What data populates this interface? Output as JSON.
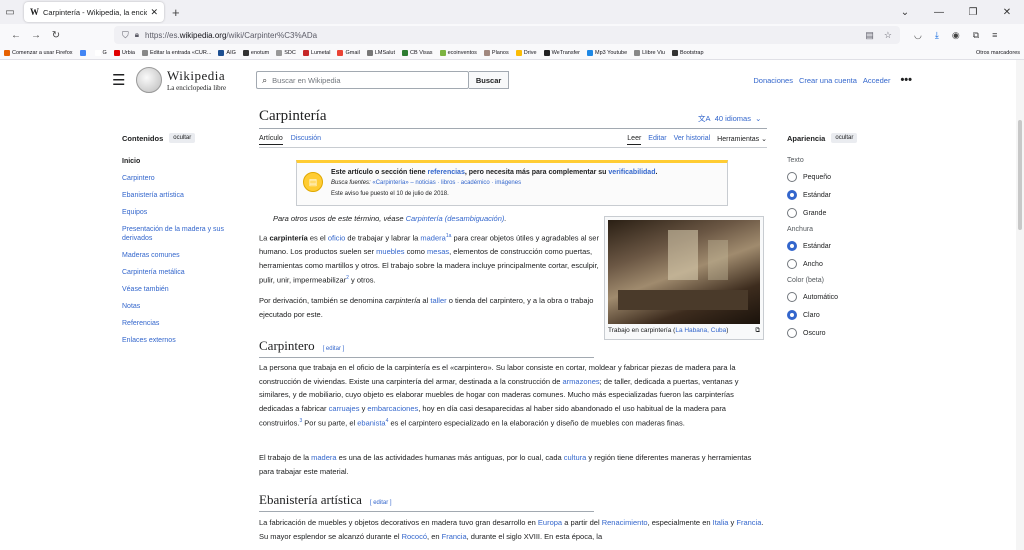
{
  "browser": {
    "tab_title": "Carpintería - Wikipedia, la encic",
    "tab_favicon": "W",
    "url_prefix": "https://es.",
    "url_host": "wikipedia.org",
    "url_path": "/wiki/Carpinter%C3%ADa",
    "bookmarks": [
      {
        "label": "Comenzar a usar Firefox",
        "color": "#e66000"
      },
      {
        "label": "",
        "color": "#4285f4"
      },
      {
        "label": "G",
        "color": "#ffffff"
      },
      {
        "label": "Urbia",
        "color": "#e00000"
      },
      {
        "label": "Editar la entrada «CUR...",
        "color": "#888888"
      },
      {
        "label": "AIG",
        "color": "#1d4f91"
      },
      {
        "label": "enotum",
        "color": "#333333"
      },
      {
        "label": "SDC",
        "color": "#999999"
      },
      {
        "label": "Lumetal",
        "color": "#c62828"
      },
      {
        "label": "Gmail",
        "color": "#ea4335"
      },
      {
        "label": "LMSalut",
        "color": "#777777"
      },
      {
        "label": "CB Visas",
        "color": "#2e7d32"
      },
      {
        "label": "ecoinventos",
        "color": "#7cb342"
      },
      {
        "label": "Planos",
        "color": "#a1887f"
      },
      {
        "label": "Drive",
        "color": "#fbbc05"
      },
      {
        "label": "WeTransfer",
        "color": "#222222"
      },
      {
        "label": "Mp3 Youtube",
        "color": "#1e88e5"
      },
      {
        "label": "Llibre Viu",
        "color": "#888888"
      },
      {
        "label": "Bootstrap",
        "color": "#333333"
      }
    ],
    "other_bookmarks": "Otros marcadores"
  },
  "header": {
    "wordmark": "Wikipedia",
    "tagline": "La enciclopedia libre",
    "search_placeholder": "Buscar en Wikipedia",
    "search_button": "Buscar",
    "donate": "Donaciones",
    "create_account": "Crear una cuenta",
    "login": "Acceder"
  },
  "toc": {
    "title": "Contenidos",
    "hide": "ocultar",
    "items": [
      "Inicio",
      "Carpintero",
      "Ebanistería artística",
      "Equipos",
      "Presentación de la madera y sus derivados",
      "Maderas comunes",
      "Carpintería metálica",
      "Véase también",
      "Notas",
      "Referencias",
      "Enlaces externos"
    ]
  },
  "article": {
    "title": "Carpintería",
    "languages": "40 idiomas",
    "tab_article": "Artículo",
    "tab_talk": "Discusión",
    "tab_read": "Leer",
    "tab_edit": "Editar",
    "tab_history": "Ver historial",
    "tab_tools": "Herramientas",
    "notice_a": "Este artículo o sección tiene ",
    "notice_link1": "referencias",
    "notice_b": ", pero necesita más para complementar su ",
    "notice_link2": "verificabilidad",
    "notice_c": ".",
    "notice_sources_label": "Busca fuentes:",
    "notice_sources": "«Carpintería» – noticias · libros · académico · imágenes",
    "notice_date": "Este aviso fue puesto el 10 de julio de 2018.",
    "hatnote_a": "Para otros usos de este término, véase ",
    "hatnote_link": "Carpintería (desambiguación)",
    "hatnote_c": ".",
    "caption_a": "Trabajo en carpintería (",
    "caption_link": "La Habana, Cuba",
    "caption_c": ")",
    "section1": "Carpintero",
    "section2": "Ebanistería artística",
    "edit_label": "[ editar ]"
  },
  "appearance": {
    "title": "Apariencia",
    "hide": "ocultar",
    "text_label": "Texto",
    "text_options": [
      "Pequeño",
      "Estándar",
      "Grande"
    ],
    "width_label": "Anchura",
    "width_options": [
      "Estándar",
      "Ancho"
    ],
    "color_label": "Color (beta)",
    "color_options": [
      "Automático",
      "Claro",
      "Oscuro"
    ],
    "selected": {
      "text": "Estándar",
      "width": "Estándar",
      "color": "Claro"
    }
  },
  "colors": {
    "link": "#3366cc",
    "notice_bar": "#ffcc33"
  }
}
